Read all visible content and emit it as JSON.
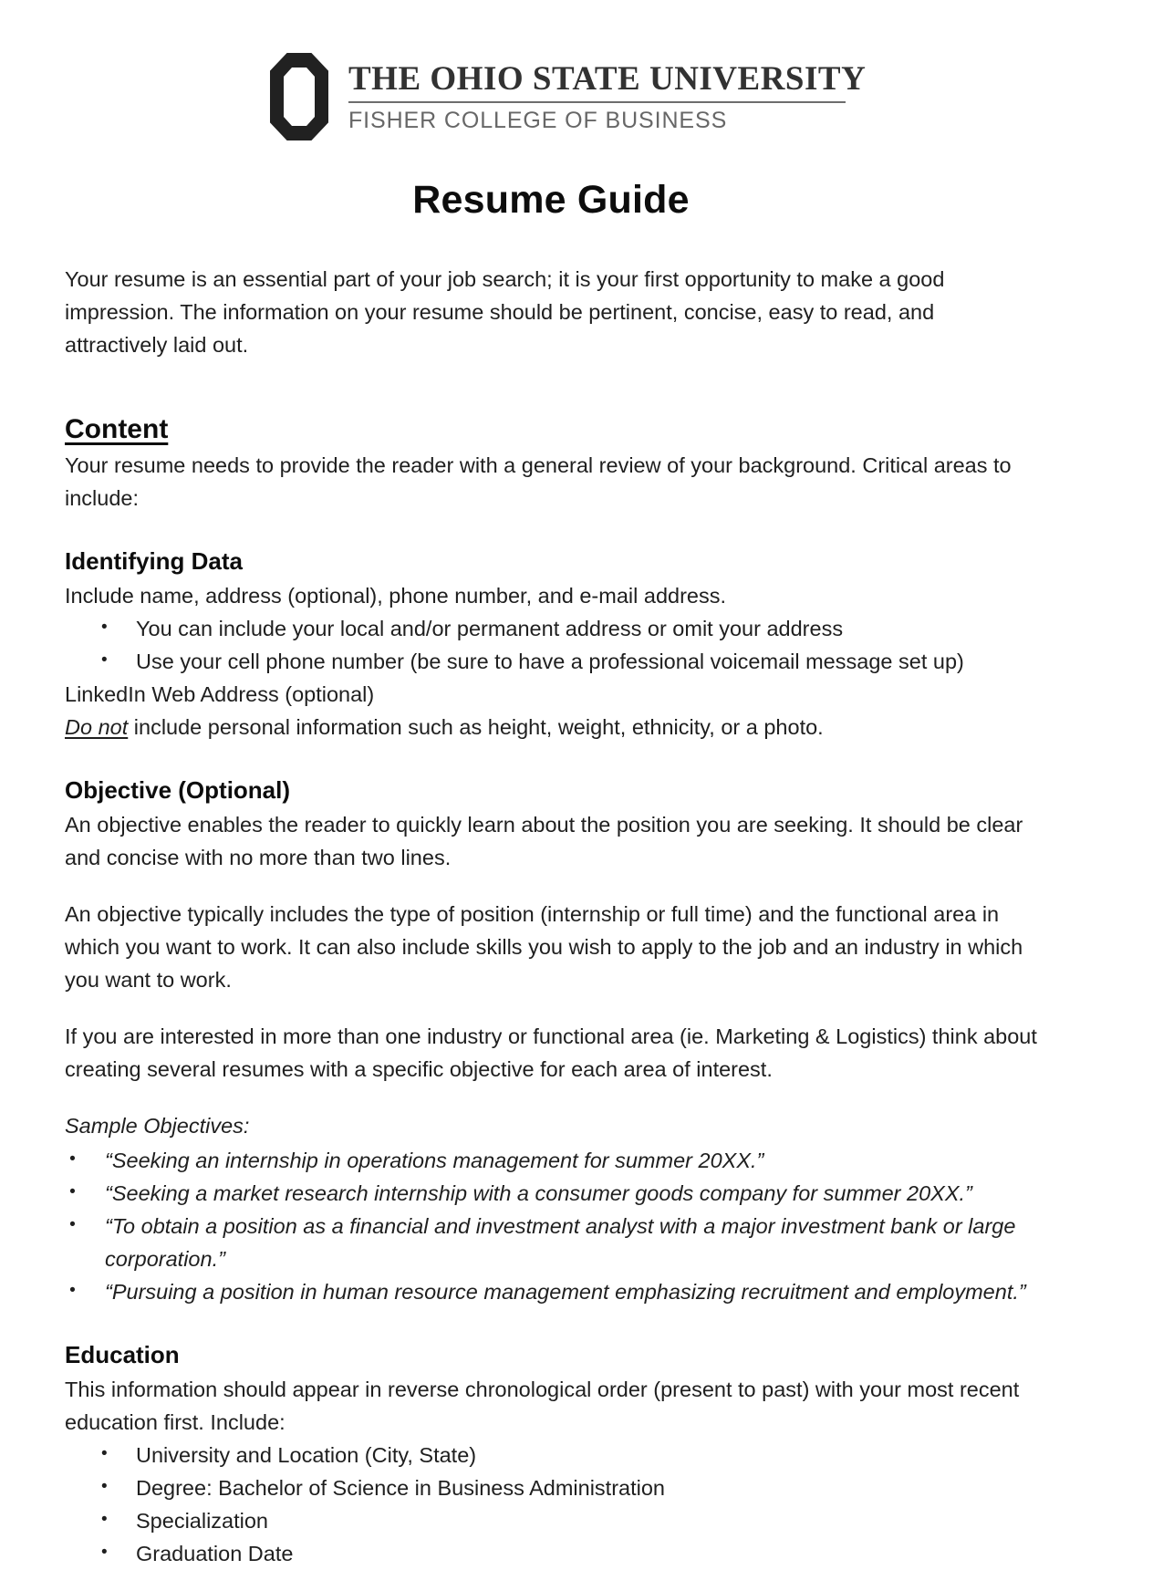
{
  "letterhead": {
    "logo_icon": "osu-block-o-icon",
    "university_name": "THE OHIO STATE UNIVERSITY",
    "university_name_parts": {
      "the": "T",
      "the_rest": "HE",
      "ohio": "O",
      "ohio_rest": "HIO",
      "state": "S",
      "state_rest": "TATE",
      "university": "U",
      "university_rest": "NIVERSITY"
    },
    "college_name": "FISHER COLLEGE OF BUSINESS"
  },
  "document": {
    "title": "Resume Guide",
    "intro": "Your resume is an essential part of your job search; it is your first opportunity to make a good impression. The information on your resume should be pertinent, concise, easy to read, and attractively laid out."
  },
  "content_section": {
    "heading": "Content",
    "lead": "Your resume needs to provide the reader with a general review of your background. Critical areas to include:"
  },
  "identifying_data": {
    "heading": "Identifying Data",
    "lead": "Include name, address (optional), phone number, and e-mail address.",
    "bullets": [
      "You can include your local and/or permanent address or omit your address",
      "Use your cell phone number (be sure to have a professional voicemail message set up)"
    ],
    "linkedin_line": "LinkedIn Web Address (optional)",
    "donot_emphasis": "Do not",
    "donot_rest": " include personal information such as height, weight, ethnicity, or a photo."
  },
  "objective": {
    "heading": "Objective (Optional)",
    "paragraphs": [
      "An objective enables the reader to quickly learn about the position you are seeking. It should be clear and concise with no more than two lines.",
      "An objective typically includes the type of position (internship or full time) and the functional area in which you want to work. It can also include skills you wish to apply to the job and an industry in which you want to work.",
      "If you are interested in more than one industry or functional area (ie. Marketing & Logistics) think about creating several resumes with a specific objective for each area of interest."
    ],
    "samples_label": "Sample Objectives:",
    "samples": [
      "“Seeking an internship in operations management for summer 20XX.”",
      "“Seeking a market research internship with a consumer goods company for summer 20XX.”",
      "“To obtain a position as a financial and investment analyst with a major investment bank or large corporation.”",
      "“Pursuing a position in human resource management emphasizing recruitment and employment.”"
    ]
  },
  "education": {
    "heading": "Education",
    "lead": "This information should appear in reverse chronological order (present to past) with your most recent education first. Include:",
    "bullets": [
      "University and Location (City, State)",
      "Degree: Bachelor of Science in Business Administration",
      "Specialization",
      "Graduation Date"
    ]
  }
}
